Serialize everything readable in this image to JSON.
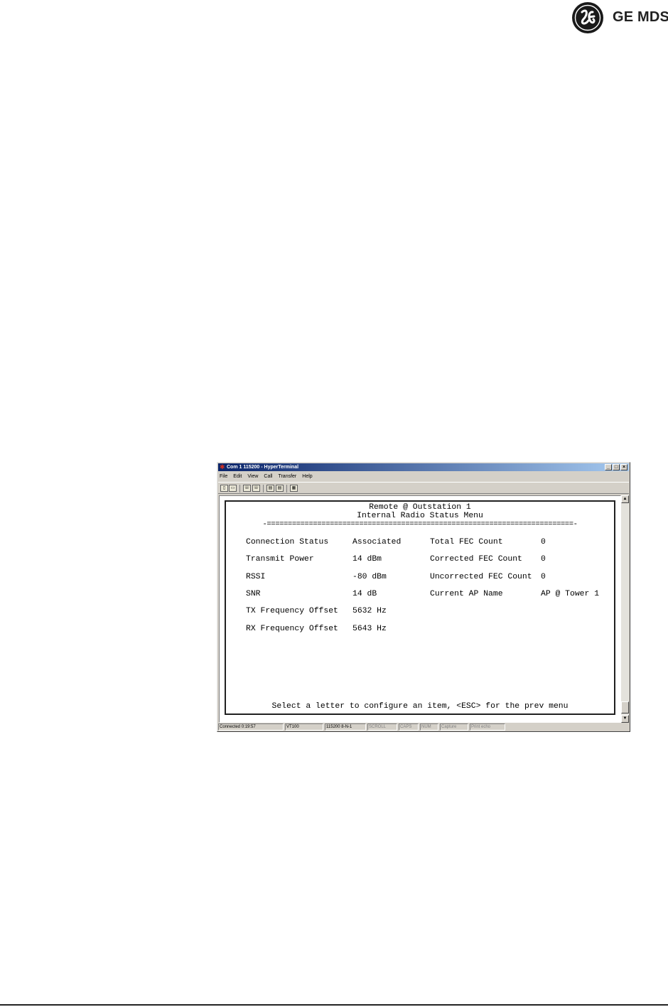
{
  "brand": {
    "logo_text": "GE MDS"
  },
  "window": {
    "title": "Com 1 115200 - HyperTerminal",
    "controls": [
      "_",
      "□",
      "×"
    ],
    "menu": [
      "File",
      "Edit",
      "View",
      "Call",
      "Transfer",
      "Help"
    ],
    "toolbar_icons": [
      "new-icon",
      "open-icon",
      "connect-icon",
      "disconnect-icon",
      "send-icon",
      "receive-icon",
      "properties-icon"
    ]
  },
  "terminal": {
    "header_line1": "Remote @ Outstation 1",
    "header_line2": "Internal Radio Status Menu",
    "divider": "-=========================================================================-",
    "left": [
      {
        "label": "Connection Status",
        "value": "Associated"
      },
      {
        "label": "Transmit Power",
        "value": "14 dBm"
      },
      {
        "label": "RSSI",
        "value": "-80 dBm"
      },
      {
        "label": "SNR",
        "value": "14 dB"
      },
      {
        "label": "TX Frequency Offset",
        "value": "5632 Hz"
      },
      {
        "label": "RX Frequency Offset",
        "value": "5643 Hz"
      }
    ],
    "right": [
      {
        "label": "Total FEC Count",
        "value": "0"
      },
      {
        "label": "Corrected FEC Count",
        "value": "0"
      },
      {
        "label": "Uncorrected FEC Count",
        "value": "0"
      },
      {
        "label": "Current AP Name",
        "value": "AP @ Tower 1"
      }
    ],
    "prompt": "Select a letter to configure an item, <ESC> for the prev menu"
  },
  "statusbar": {
    "connected": "Connected 0:19:57",
    "emulation": "VT100",
    "settings": "115200 8-N-1",
    "scroll": "SCROLL",
    "caps": "CAPS",
    "num": "NUM",
    "capture": "Capture",
    "print_echo": "Print echo"
  }
}
